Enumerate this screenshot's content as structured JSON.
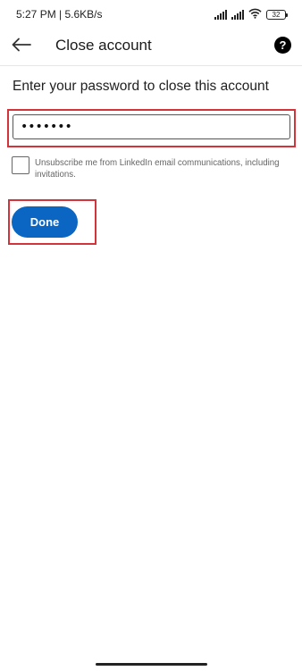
{
  "status_bar": {
    "time_speed": "5:27 PM | 5.6KB/s",
    "battery_level": "32"
  },
  "app_bar": {
    "title": "Close account",
    "back_icon": "arrow-left-icon",
    "help_icon": "question-circle-icon",
    "help_glyph": "?"
  },
  "form": {
    "prompt": "Enter your password to close this account",
    "password_value": "•••••••",
    "unsubscribe_label": "Unsubscribe me from LinkedIn email communications, including invitations.",
    "unsubscribe_checked": false,
    "done_label": "Done"
  },
  "colors": {
    "primary": "#0a66c2",
    "highlight": "#d3343b"
  }
}
